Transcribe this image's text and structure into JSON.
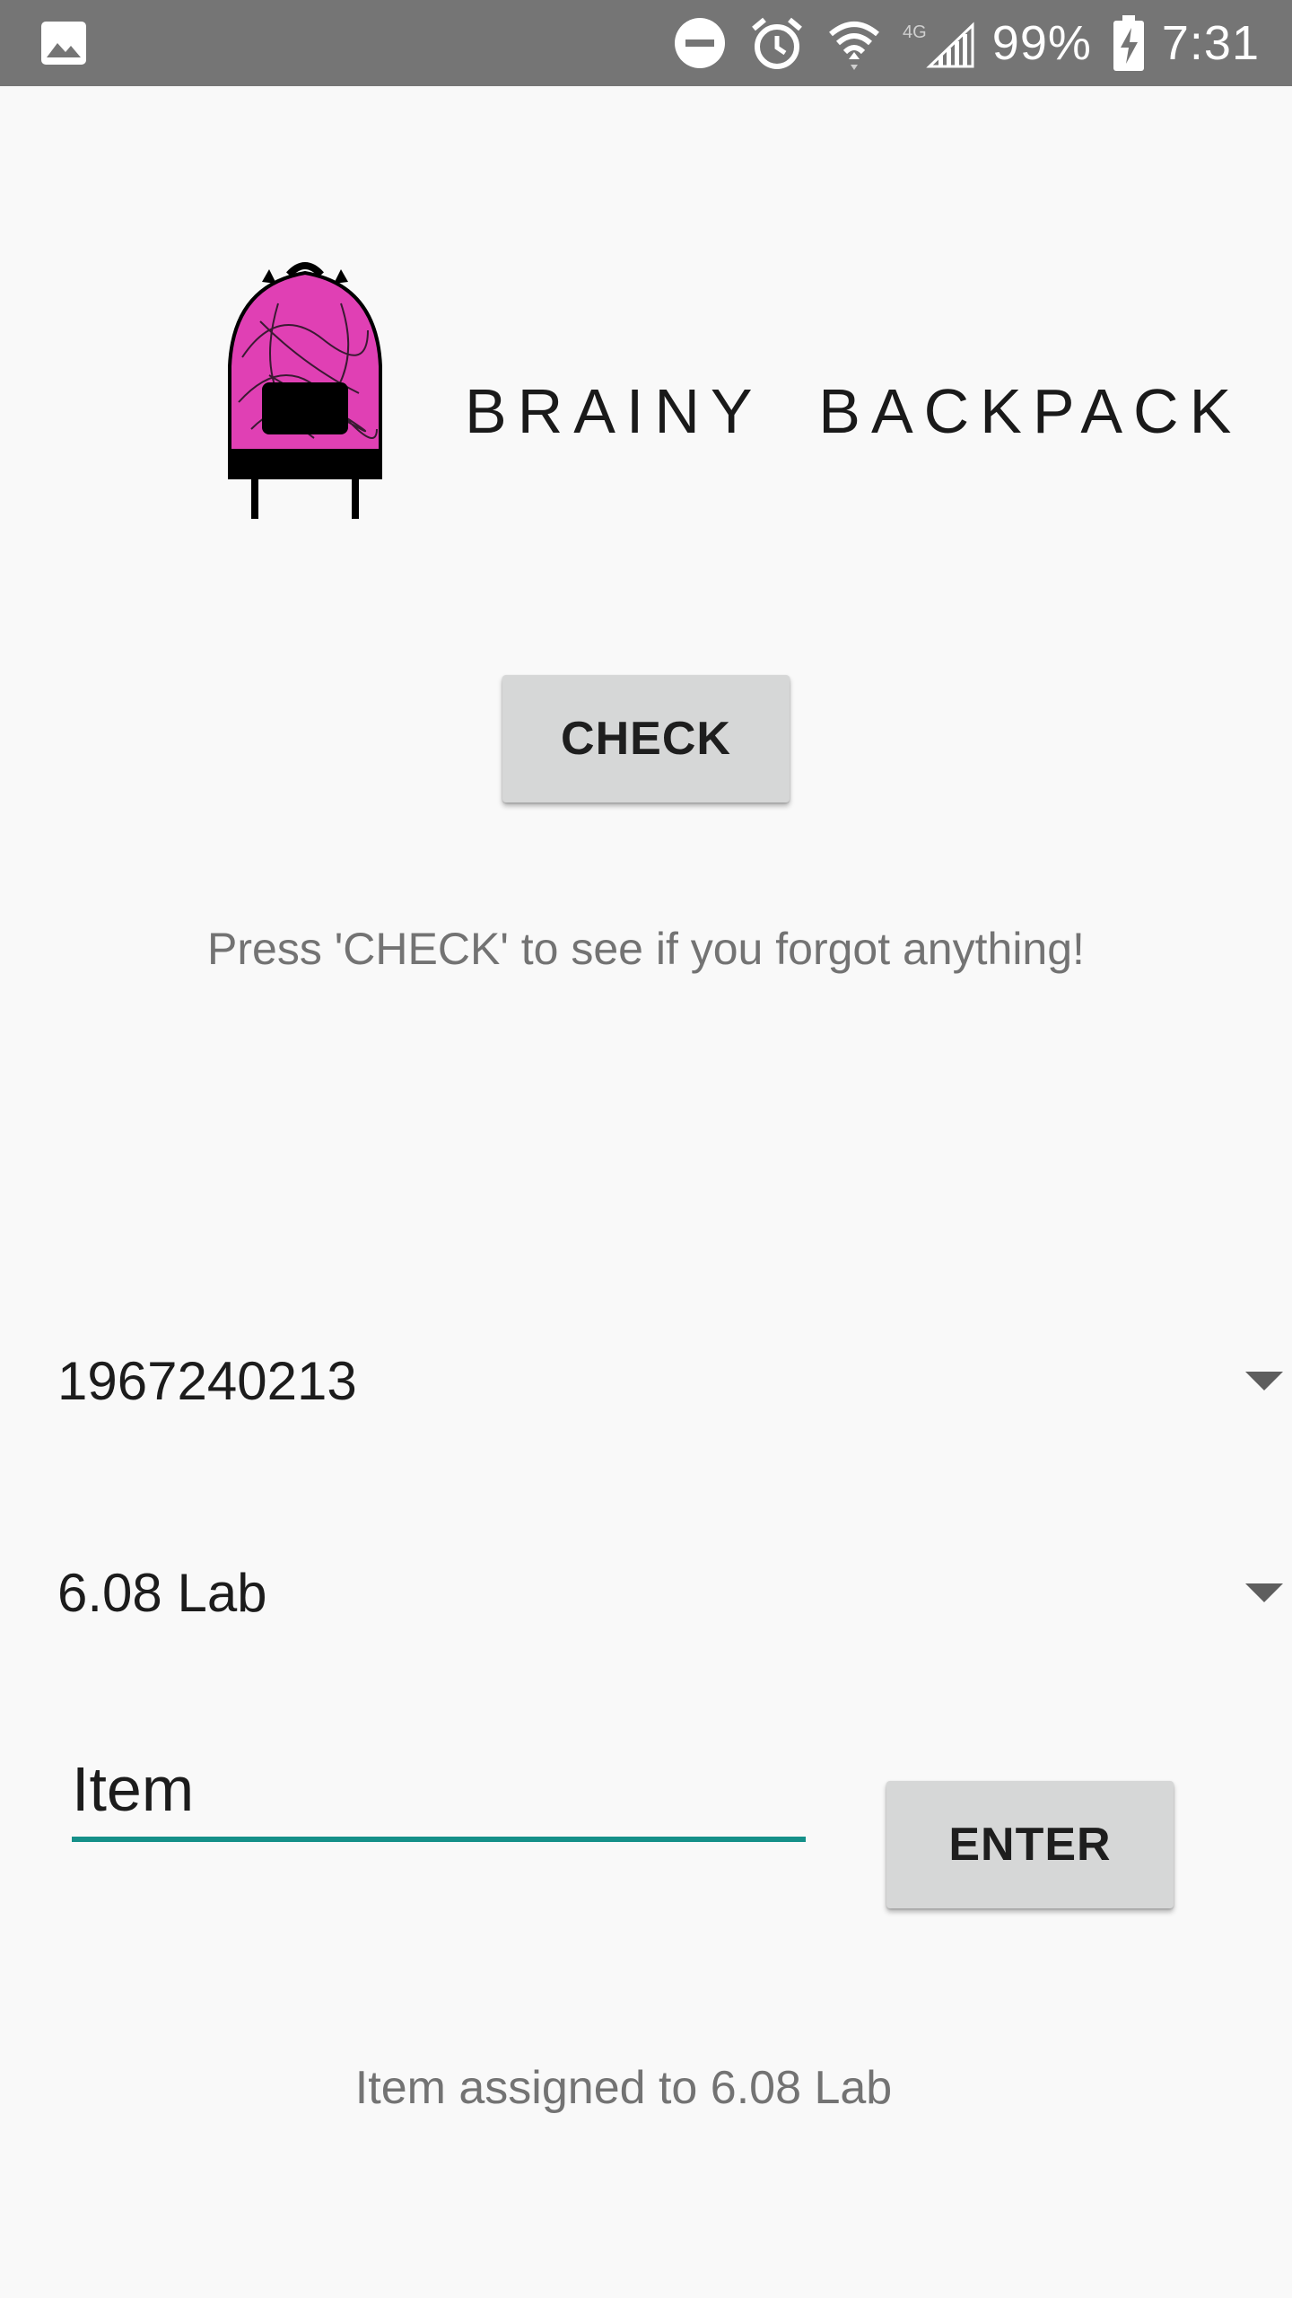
{
  "status_bar": {
    "battery": "99%",
    "time": "7:31",
    "network": "4G",
    "icons": [
      "gallery-icon",
      "do-not-disturb-icon",
      "alarm-icon",
      "wifi-icon",
      "signal-icon",
      "battery-charging-icon"
    ]
  },
  "header": {
    "logo": "backpack-logo",
    "title": "BRAINY  BACKPACK"
  },
  "check_button": {
    "label": "CHECK"
  },
  "hint_text": "Press 'CHECK' to see if you forgot anything!",
  "spinners": {
    "device": {
      "selected": "1967240213"
    },
    "location": {
      "selected": "6.08 Lab"
    }
  },
  "item_input": {
    "value": "",
    "placeholder": "Item"
  },
  "enter_button": {
    "label": "ENTER"
  },
  "result_text": "Item assigned to 6.08 Lab",
  "colors": {
    "status_bar": "#757575",
    "background": "#f9f9f9",
    "button": "#d6d7d7",
    "input_underline": "#159089",
    "backpack_pink": "#e040b4"
  }
}
